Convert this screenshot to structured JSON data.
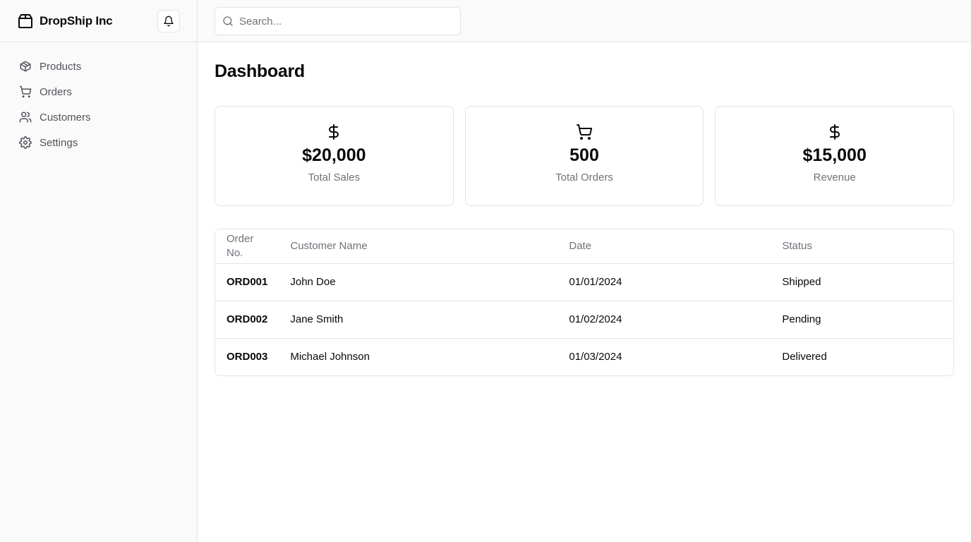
{
  "app": {
    "brand_name": "DropShip Inc",
    "brand_icon": "package-icon",
    "notifications_icon": "bell-icon"
  },
  "sidebar": {
    "items": [
      {
        "label": "Products",
        "icon": "box-icon"
      },
      {
        "label": "Orders",
        "icon": "shopping-cart-icon"
      },
      {
        "label": "Customers",
        "icon": "users-icon"
      },
      {
        "label": "Settings",
        "icon": "gear-icon"
      }
    ]
  },
  "search": {
    "placeholder": "Search...",
    "value": ""
  },
  "main": {
    "title": "Dashboard",
    "cards": [
      {
        "icon": "dollar-icon",
        "value": "$20,000",
        "label": "Total Sales"
      },
      {
        "icon": "shopping-cart-icon",
        "value": "500",
        "label": "Total Orders"
      },
      {
        "icon": "dollar-icon",
        "value": "$15,000",
        "label": "Revenue"
      }
    ],
    "table": {
      "headers": [
        "Order\nNo.",
        "Customer Name",
        "Date",
        "Status"
      ],
      "rows": [
        {
          "order_no": "ORD001",
          "customer": "John Doe",
          "date": "01/01/2024",
          "status": "Shipped"
        },
        {
          "order_no": "ORD002",
          "customer": "Jane Smith",
          "date": "01/02/2024",
          "status": "Pending"
        },
        {
          "order_no": "ORD003",
          "customer": "Michael Johnson",
          "date": "01/03/2024",
          "status": "Delivered"
        }
      ]
    }
  },
  "colors": {
    "sidebar_bg": "#fafafa",
    "border": "#e4e4e7",
    "muted_text": "#71717a",
    "text": "#09090b"
  }
}
